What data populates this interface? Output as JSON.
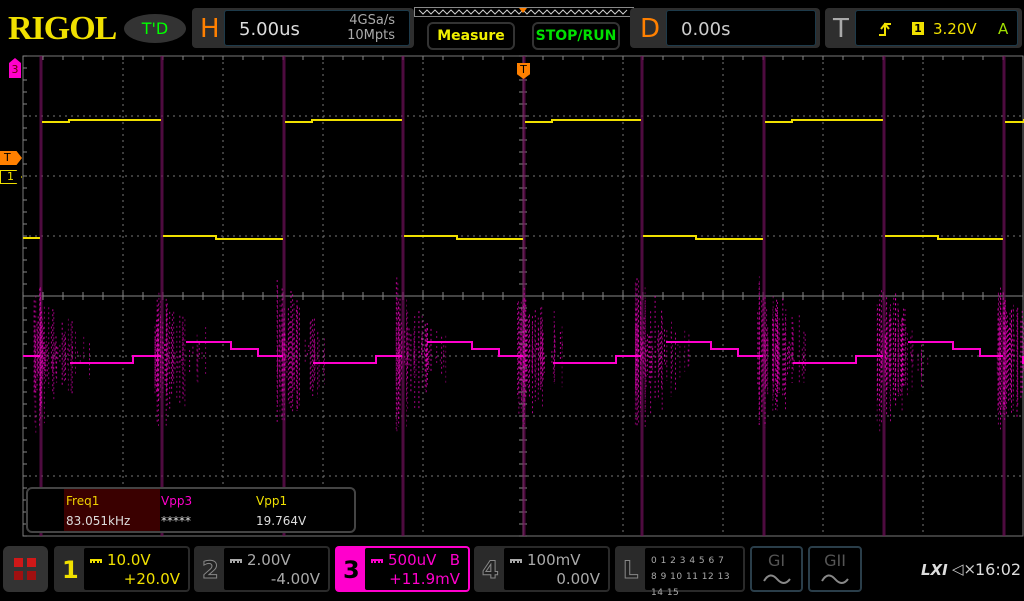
{
  "header": {
    "logo": "RIGOL",
    "status": "T'D",
    "horizontal": {
      "label": "H",
      "timebase": "5.00us",
      "sample_rate": "4GSa/s",
      "memory_depth": "10Mpts"
    },
    "measure_label": "Measure",
    "stop_run_label": "STOP/RUN",
    "delay": {
      "label": "D",
      "value": "0.00s"
    },
    "trigger": {
      "label": "T",
      "source": "1",
      "level": "3.20V",
      "mode": "A",
      "edge_icon": "rising-edge-icon"
    }
  },
  "markers": {
    "ch3": "3",
    "trigger": "T",
    "ch1": "1",
    "trigger_top": "T"
  },
  "measurements": [
    {
      "name": "Freq1",
      "value": "83.051kHz",
      "color": "#f0d000"
    },
    {
      "name": "Vpp3",
      "value": "*****",
      "color": "#ff00cc"
    },
    {
      "name": "Vpp1",
      "value": "19.764V",
      "color": "#f0e000"
    }
  ],
  "channels": [
    {
      "num": "1",
      "scale": "10.0V",
      "offset": "+20.0V",
      "color": "#f0e000",
      "active": true
    },
    {
      "num": "2",
      "scale": "2.00V",
      "offset": "-4.00V",
      "color": "#aaaaaa",
      "active": false
    },
    {
      "num": "3",
      "scale": "500uV",
      "offset": "+11.9mV",
      "flag": "B",
      "color": "#ff00cc",
      "active": true
    },
    {
      "num": "4",
      "scale": "100mV",
      "offset": "0.00V",
      "color": "#aaaaaa",
      "active": false
    }
  ],
  "logic": {
    "label": "L",
    "row1": "0 1 2 3  4 5 6 7",
    "row2": "8 9 10 11 12 13 14 15"
  },
  "generators": [
    {
      "label": "GI"
    },
    {
      "label": "GII"
    }
  ],
  "status_bar": {
    "lxi": "LXI",
    "time": "16:02",
    "sound_icon": "speaker-muted-icon"
  },
  "colors": {
    "ch1": "#f0e000",
    "ch3": "#ff00cc",
    "trigger": "#ff8000",
    "grid": "#777777"
  }
}
